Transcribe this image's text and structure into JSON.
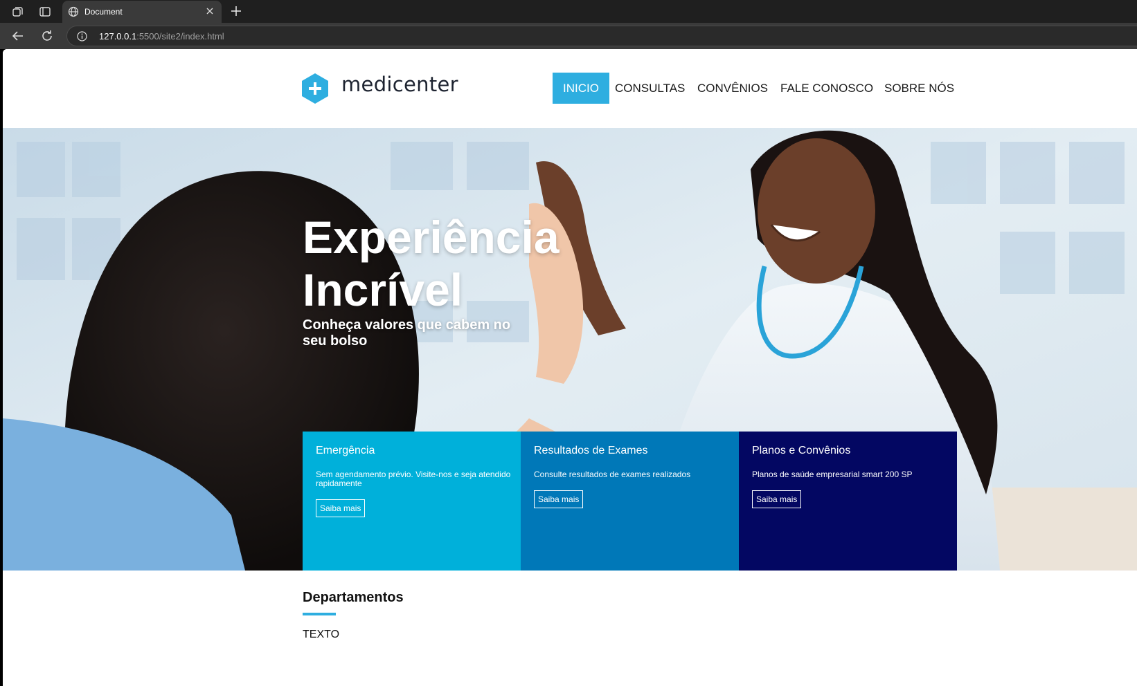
{
  "browser": {
    "tab_title": "Document",
    "url_host": "127.0.0.1",
    "url_rest": ":5500/site2/index.html",
    "icons": [
      "workspaces-icon",
      "tab-actions-icon",
      "globe-icon",
      "close-icon",
      "new-tab-icon",
      "back-icon",
      "refresh-icon",
      "info-icon"
    ]
  },
  "site": {
    "brand": "medicenter",
    "brand_color": "#2eaee0",
    "nav": [
      {
        "label": "INICIO",
        "active": true
      },
      {
        "label": "CONSULTAS",
        "active": false
      },
      {
        "label": "CONVÊNIOS",
        "active": false
      },
      {
        "label": "FALE CONOSCO",
        "active": false
      },
      {
        "label": "SOBRE NÓS",
        "active": false
      }
    ]
  },
  "hero": {
    "title_line1": "Experiência",
    "title_line2": "Incrível",
    "subtitle": "Conheça valores que cabem no seu bolso"
  },
  "cards": [
    {
      "title": "Emergência",
      "desc": "Sem agendamento prévio. Visite-nos e seja atendido rapidamente",
      "button": "Saiba mais",
      "color": "#00b0da"
    },
    {
      "title": "Resultados de Exames",
      "desc": "Consulte resultados de exames realizados",
      "button": "Saiba mais",
      "color": "#0078b8"
    },
    {
      "title": "Planos e Convênios",
      "desc": "Planos de saúde empresarial smart 200 SP",
      "button": "Saiba mais",
      "color": "#030762"
    }
  ],
  "departments": {
    "title": "Departamentos",
    "text": "TEXTO"
  }
}
